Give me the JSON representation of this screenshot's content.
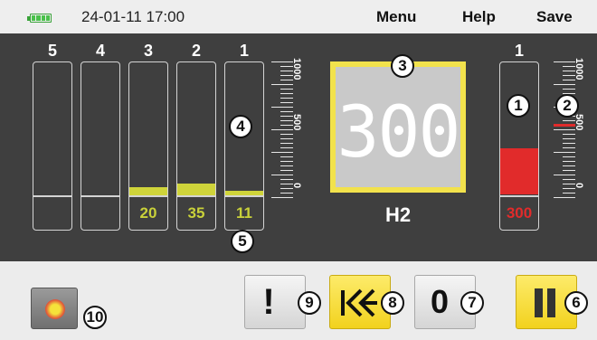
{
  "status_bar": {
    "battery_icon": "battery-icon",
    "datetime": "24-01-11 17:00",
    "menu_label": "Menu",
    "help_label": "Help",
    "save_label": "Save"
  },
  "channels": [
    {
      "number": "5",
      "reading": "",
      "has_level": false
    },
    {
      "number": "4",
      "reading": "",
      "has_level": false
    },
    {
      "number": "3",
      "reading": "20",
      "has_level": true
    },
    {
      "number": "2",
      "reading": "35",
      "has_level": true
    },
    {
      "number": "1",
      "reading": "11",
      "has_level": true
    }
  ],
  "scale_left": {
    "labels": [
      "1000",
      "500",
      "0"
    ]
  },
  "main_display": {
    "value": "300",
    "gas": "H2"
  },
  "right_channel": {
    "number": "1",
    "reading": "300",
    "fill_fraction": 0.3
  },
  "scale_right": {
    "labels": [
      "1000",
      "500",
      "0"
    ]
  },
  "callouts": {
    "c1": "1",
    "c2": "2",
    "c3": "3",
    "c4": "4",
    "c5": "5",
    "c6": "6",
    "c7": "7",
    "c8": "8",
    "c9": "9",
    "c10": "10"
  },
  "buttons": {
    "alarm_glyph": "!",
    "zero_glyph": "0",
    "back_icon": "skip-back-icon",
    "pause_icon": "pause-icon",
    "record_icon": "record-icon"
  },
  "colors": {
    "panel": "#3f3f3f",
    "level_yellow": "#cfd43a",
    "alarm_red": "#e12b2b",
    "display_border": "#f2e24c",
    "button_yellow": "#f2d21e"
  }
}
